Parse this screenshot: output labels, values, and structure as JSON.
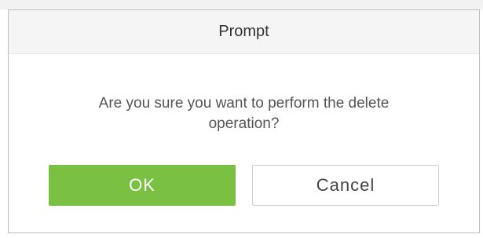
{
  "dialog": {
    "title": "Prompt",
    "message_line1": "Are you sure you want to perform the delete",
    "message_line2": "operation?",
    "ok_label": "OK",
    "cancel_label": "Cancel"
  },
  "colors": {
    "header_bg": "#f5f5f5",
    "ok_bg": "#7ac143",
    "cancel_border": "#cfcfcf",
    "dialog_border": "#bdbdbd"
  }
}
